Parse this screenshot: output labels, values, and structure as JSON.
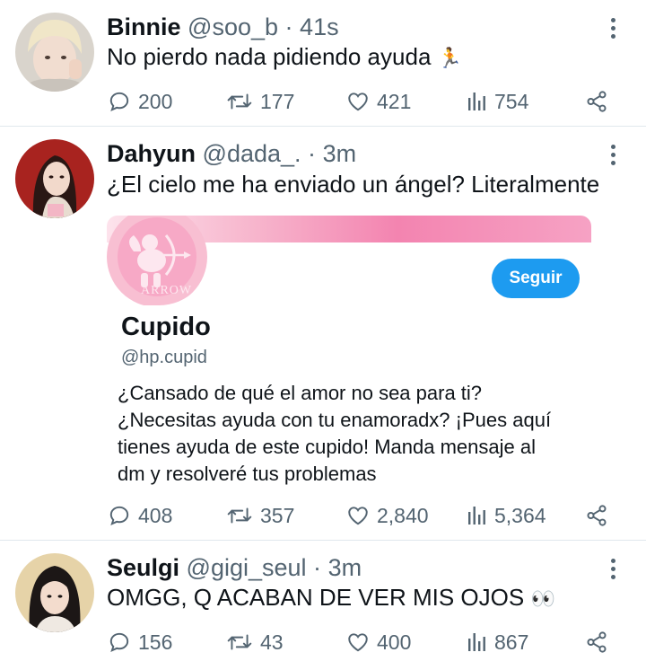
{
  "tweets": [
    {
      "name": "Binnie",
      "handle": "@soo_b",
      "dot": "·",
      "time": "41s",
      "text": "No pierdo nada pidiendo ayuda",
      "emoji": "🏃",
      "replies": "200",
      "retweets": "177",
      "likes": "421",
      "views": "754"
    },
    {
      "name": "Dahyun",
      "handle": "@dada_.",
      "dot": "·",
      "time": "3m",
      "text": "¿El cielo me ha enviado un ángel? Literalmente",
      "replies": "408",
      "retweets": "357",
      "likes": "2,840",
      "views": "5,364",
      "card": {
        "avatar_text": "ARROW",
        "follow_label": "Seguir",
        "name": "Cupido",
        "handle": "@hp.cupid",
        "bio_lines": [
          "¿Cansado de qué el amor no sea para ti?",
          "¿Necesitas ayuda con tu enamoradx? ¡Pues aquí",
          "tienes ayuda de este cupido! Manda mensaje al",
          "dm y resolveré tus problemas"
        ]
      }
    },
    {
      "name": "Seulgi",
      "handle": "@gigi_seul",
      "dot": "·",
      "time": "3m",
      "text": "OMGG, Q ACABAN DE VER MIS OJOS",
      "emoji": "👀",
      "replies": "156",
      "retweets": "43",
      "likes": "400",
      "views": "867"
    }
  ],
  "colors": {
    "secondary_text": "#536471",
    "follow_button": "#1d9bf0",
    "divider": "#e1e8ed"
  },
  "icons": [
    "reply-icon",
    "retweet-icon",
    "like-icon",
    "views-icon",
    "share-icon",
    "more-icon"
  ]
}
